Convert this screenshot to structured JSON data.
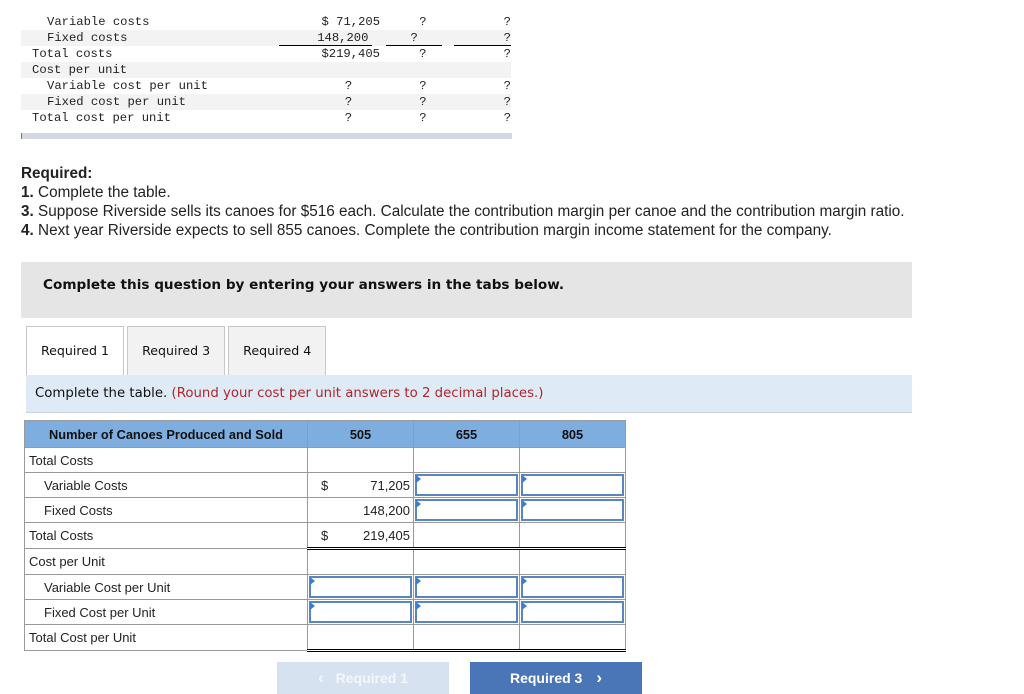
{
  "given_table": {
    "rows": [
      {
        "label": "Variable costs",
        "indent": true,
        "c1": "$ 71,205",
        "c2": "?",
        "c3": "?"
      },
      {
        "label": "Fixed costs",
        "indent": true,
        "c1": "148,200",
        "c2": "?",
        "c3": "?"
      },
      {
        "label": "Total costs",
        "indent": false,
        "c1": "$219,405",
        "c2": "?",
        "c3": "?"
      },
      {
        "label": "Cost per unit",
        "indent": false,
        "c1": "",
        "c2": "",
        "c3": ""
      },
      {
        "label": "Variable cost per unit",
        "indent": true,
        "c1": "?",
        "c2": "?",
        "c3": "?"
      },
      {
        "label": "Fixed cost per unit",
        "indent": true,
        "c1": "?",
        "c2": "?",
        "c3": "?"
      },
      {
        "label": "Total cost per unit",
        "indent": false,
        "c1": "?",
        "c2": "?",
        "c3": "?"
      }
    ]
  },
  "required": {
    "title": "Required:",
    "items": [
      {
        "num": "1.",
        "text": " Complete the table."
      },
      {
        "num": "3.",
        "text": " Suppose Riverside sells its canoes for $516 each. Calculate the contribution margin per canoe and the contribution margin ratio."
      },
      {
        "num": "4.",
        "text": " Next year Riverside expects to sell 855 canoes. Complete the contribution margin income statement for the company."
      }
    ]
  },
  "banner": "Complete this question by entering your answers in the tabs below.",
  "tabs": [
    {
      "label": "Required 1",
      "active": true
    },
    {
      "label": "Required 3",
      "active": false
    },
    {
      "label": "Required 4",
      "active": false
    }
  ],
  "instruction": {
    "main": "Complete the table. ",
    "note": "(Round your cost per unit answers to 2 decimal places.)"
  },
  "answer_table": {
    "headers": [
      "Number of Canoes Produced and Sold",
      "505",
      "655",
      "805"
    ],
    "rows": {
      "total_costs_heading": "Total Costs",
      "variable_costs": {
        "label": "Variable Costs",
        "c1_dollar": "$",
        "c1": "71,205"
      },
      "fixed_costs": {
        "label": "Fixed Costs",
        "c1": "148,200"
      },
      "total_costs": {
        "label": "Total Costs",
        "c1_dollar": "$",
        "c1": "219,405"
      },
      "cost_per_unit_heading": "Cost per Unit",
      "variable_cost_per_unit": {
        "label": "Variable Cost per Unit"
      },
      "fixed_cost_per_unit": {
        "label": "Fixed Cost per Unit"
      },
      "total_cost_per_unit": {
        "label": "Total Cost per Unit"
      }
    }
  },
  "nav": {
    "prev_label": "Required 1",
    "next_label": "Required 3",
    "prev_icon": "‹",
    "next_icon": "›"
  }
}
